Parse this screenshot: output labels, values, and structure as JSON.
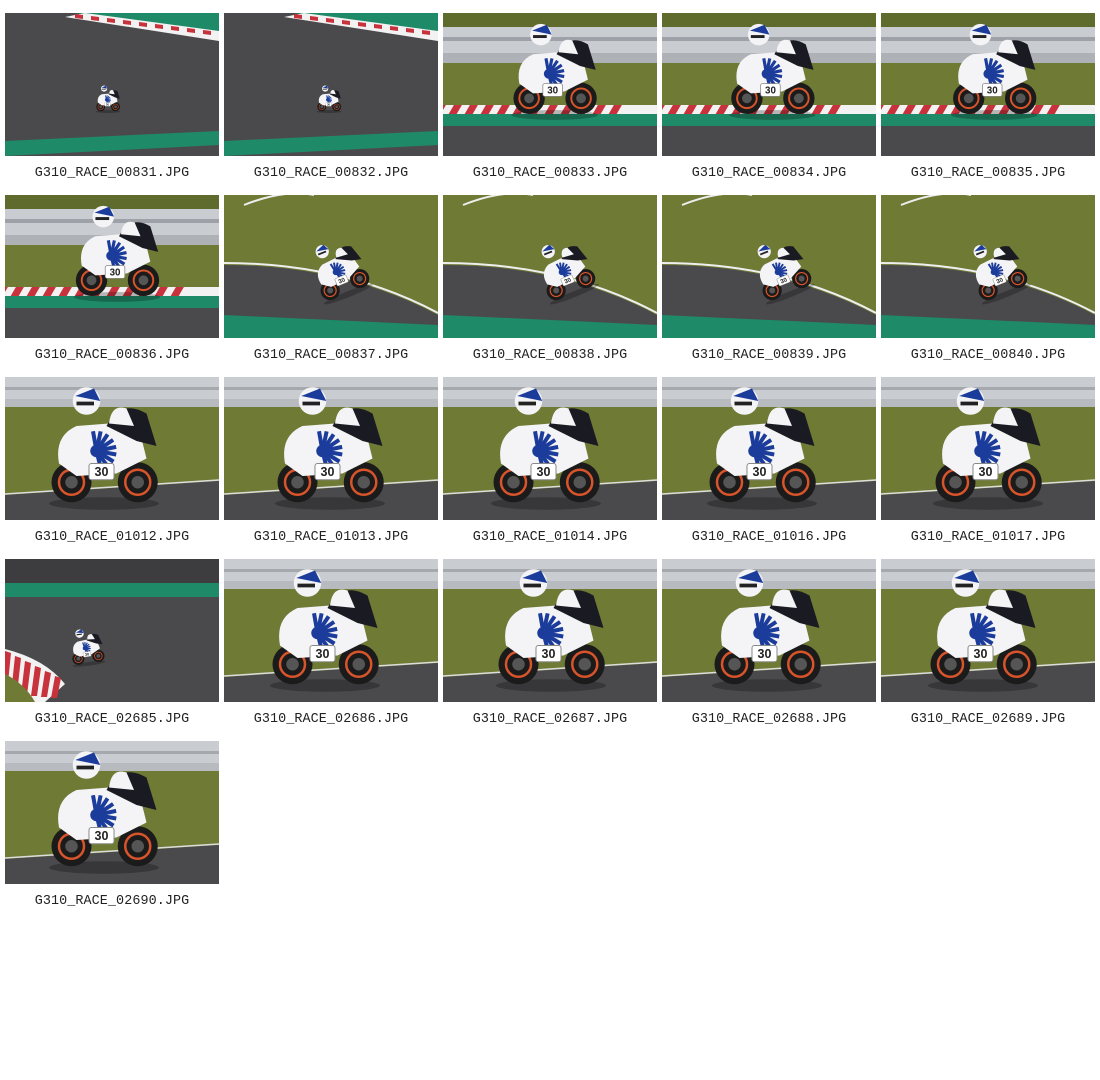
{
  "gallery": {
    "items": [
      {
        "filename": "G310_RACE_00831.JPG",
        "scene": "track-wide-curb-top"
      },
      {
        "filename": "G310_RACE_00832.JPG",
        "scene": "track-wide-curb-top"
      },
      {
        "filename": "G310_RACE_00833.JPG",
        "scene": "barrier-curb-close"
      },
      {
        "filename": "G310_RACE_00834.JPG",
        "scene": "barrier-curb-close"
      },
      {
        "filename": "G310_RACE_00835.JPG",
        "scene": "barrier-curb-close"
      },
      {
        "filename": "G310_RACE_00836.JPG",
        "scene": "barrier-curb-close"
      },
      {
        "filename": "G310_RACE_00837.JPG",
        "scene": "grass-corner-lean"
      },
      {
        "filename": "G310_RACE_00838.JPG",
        "scene": "grass-corner-lean"
      },
      {
        "filename": "G310_RACE_00839.JPG",
        "scene": "grass-corner-lean"
      },
      {
        "filename": "G310_RACE_00840.JPG",
        "scene": "grass-corner-lean"
      },
      {
        "filename": "G310_RACE_01012.JPG",
        "scene": "grass-barrier-closeup"
      },
      {
        "filename": "G310_RACE_01013.JPG",
        "scene": "grass-barrier-closeup"
      },
      {
        "filename": "G310_RACE_01014.JPG",
        "scene": "grass-barrier-closeup"
      },
      {
        "filename": "G310_RACE_01016.JPG",
        "scene": "grass-barrier-closeup"
      },
      {
        "filename": "G310_RACE_01017.JPG",
        "scene": "grass-barrier-closeup"
      },
      {
        "filename": "G310_RACE_02685.JPG",
        "scene": "track-wide-curb-left"
      },
      {
        "filename": "G310_RACE_02686.JPG",
        "scene": "grass-barrier-closeup"
      },
      {
        "filename": "G310_RACE_02687.JPG",
        "scene": "grass-barrier-closeup"
      },
      {
        "filename": "G310_RACE_02688.JPG",
        "scene": "grass-barrier-closeup"
      },
      {
        "filename": "G310_RACE_02689.JPG",
        "scene": "grass-barrier-closeup"
      },
      {
        "filename": "G310_RACE_02690.JPG",
        "scene": "grass-barrier-closeup"
      }
    ],
    "race_number": "30",
    "colors": {
      "asphalt": "#4a4a4c",
      "grass": "#6f7a35",
      "barrier": "#c9ccd0",
      "curb_red": "#c8323c",
      "curb_white": "#f2f2f2",
      "curb_green": "#1f8a68",
      "fairing_white": "#f4f4f6",
      "fairing_blue": "#1c3c9c",
      "tire": "#1b1b1b",
      "brake_orange": "#d8542a"
    }
  }
}
